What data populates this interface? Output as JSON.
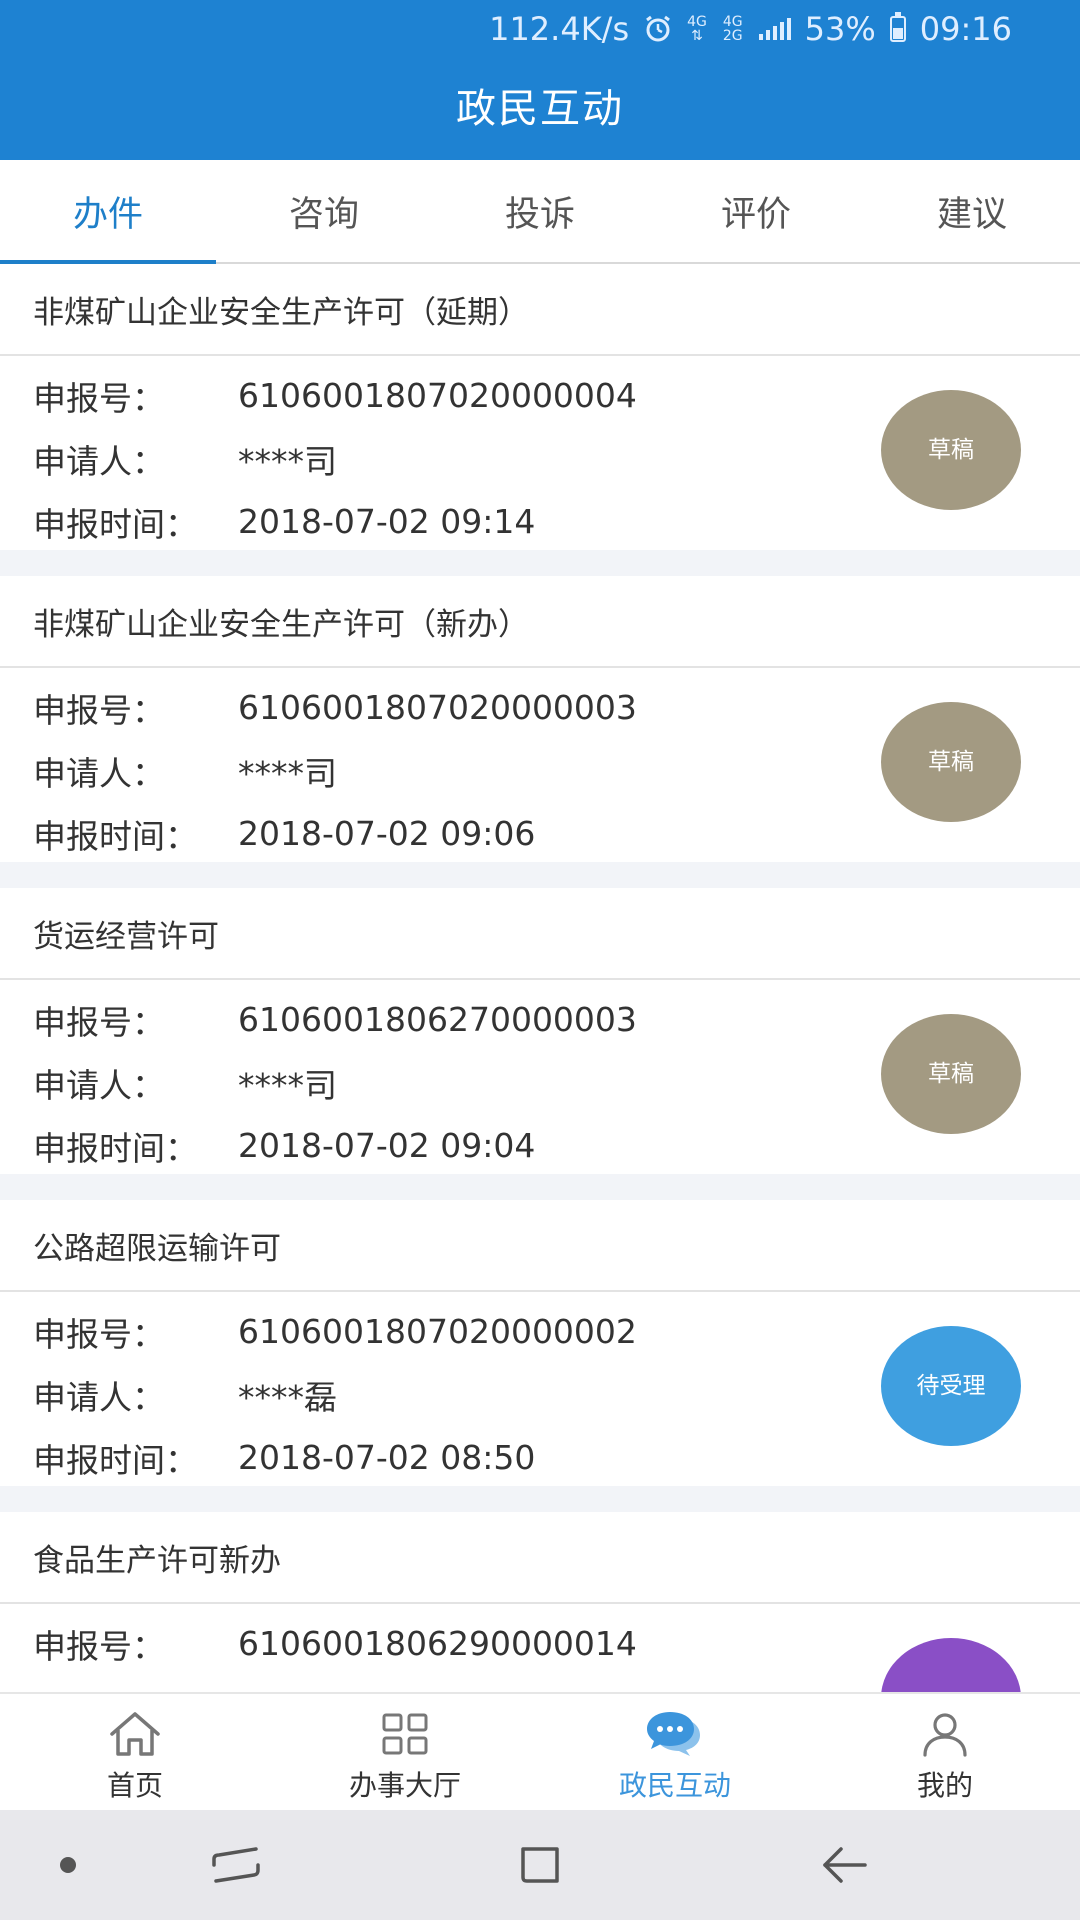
{
  "status_bar": {
    "speed": "112.4K/s",
    "network_top": "4G",
    "network_stack_top": "4G",
    "network_stack_bottom": "2G",
    "battery": "53%",
    "time": "09:16"
  },
  "header": {
    "title": "政民互动"
  },
  "tabs": [
    {
      "label": "办件",
      "active": true
    },
    {
      "label": "咨询",
      "active": false
    },
    {
      "label": "投诉",
      "active": false
    },
    {
      "label": "评价",
      "active": false
    },
    {
      "label": "建议",
      "active": false
    }
  ],
  "labels": {
    "number": "申报号：",
    "applicant": "申请人：",
    "time": "申报时间："
  },
  "items": [
    {
      "title": "非煤矿山企业安全生产许可（延期）",
      "number": "6106001807020000004",
      "applicant": "****司",
      "time": "2018-07-02 09:14",
      "status": "草稿",
      "status_color": "#a39a82"
    },
    {
      "title": "非煤矿山企业安全生产许可（新办）",
      "number": "6106001807020000003",
      "applicant": "****司",
      "time": "2018-07-02 09:06",
      "status": "草稿",
      "status_color": "#a39a82"
    },
    {
      "title": "货运经营许可",
      "number": "6106001806270000003",
      "applicant": "****司",
      "time": "2018-07-02 09:04",
      "status": "草稿",
      "status_color": "#a39a82"
    },
    {
      "title": "公路超限运输许可",
      "number": "6106001807020000002",
      "applicant": "****磊",
      "time": "2018-07-02 08:50",
      "status": "待受理",
      "status_color": "#3f9fe0"
    },
    {
      "title": "食品生产许可新办",
      "number": "6106001806290000014",
      "applicant": "",
      "time": "",
      "status": "",
      "status_color": "#8a4fc6"
    }
  ],
  "bottom_nav": [
    {
      "label": "首页",
      "icon": "home-icon",
      "active": false
    },
    {
      "label": "办事大厅",
      "icon": "grid-icon",
      "active": false
    },
    {
      "label": "政民互动",
      "icon": "chat-bubble-icon",
      "active": true
    },
    {
      "label": "我的",
      "icon": "person-icon",
      "active": false
    }
  ],
  "colors": {
    "primary": "#1e82d2",
    "tab_active": "#1e7fc9",
    "nav_active": "#3c95dc",
    "draft_badge": "#a39a82",
    "pending_badge": "#3f9fe0"
  }
}
